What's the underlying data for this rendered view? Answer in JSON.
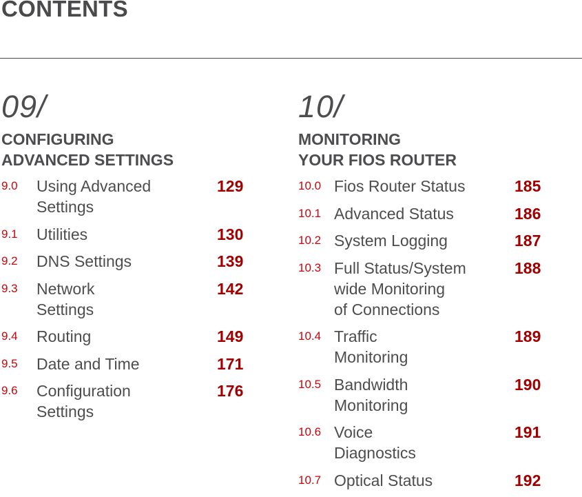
{
  "page": {
    "title": "CONTENTS"
  },
  "colors": {
    "section_number": "#cd040b",
    "page_number": "#a00000",
    "text": "#4d4d4f"
  },
  "chapters": [
    {
      "number": "09/",
      "title": "CONFIGURING\nADVANCED SETTINGS",
      "entries": [
        {
          "num": "9.0",
          "label": "Using Advanced\nSettings",
          "page": "129"
        },
        {
          "num": "9.1",
          "label": "Utilities",
          "page": "130"
        },
        {
          "num": "9.2",
          "label": "DNS Settings",
          "page": "139"
        },
        {
          "num": "9.3",
          "label": "Network\nSettings",
          "page": "142"
        },
        {
          "num": "9.4",
          "label": "Routing",
          "page": "149"
        },
        {
          "num": "9.5",
          "label": "Date and Time",
          "page": "171"
        },
        {
          "num": "9.6",
          "label": "Configuration\nSettings",
          "page": "176"
        }
      ]
    },
    {
      "number": "10/",
      "title": "MONITORING\nYOUR FIOS ROUTER",
      "entries": [
        {
          "num": "10.0",
          "label": "Fios Router Status",
          "page": "185"
        },
        {
          "num": "10.1",
          "label": "Advanced Status",
          "page": "186"
        },
        {
          "num": "10.2",
          "label": "System Logging",
          "page": "187"
        },
        {
          "num": "10.3",
          "label": "Full Status/System\nwide Monitoring\nof Connections",
          "page": "188"
        },
        {
          "num": "10.4",
          "label": "Traffic\nMonitoring",
          "page": "189"
        },
        {
          "num": "10.5",
          "label": "Bandwidth\nMonitoring",
          "page": "190"
        },
        {
          "num": "10.6",
          "label": "Voice\nDiagnostics",
          "page": "191"
        },
        {
          "num": "10.7",
          "label": "Optical Status",
          "page": "192"
        }
      ]
    }
  ]
}
